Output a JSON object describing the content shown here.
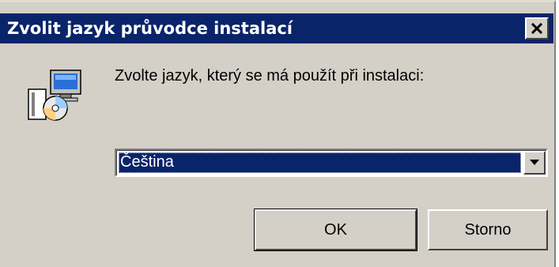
{
  "window": {
    "title": "Zvolit jazyk průvodce instalací",
    "close_icon": "close-icon"
  },
  "dialog": {
    "icon": "setup-installer-icon",
    "prompt": "Zvolte jazyk, který se má použít při instalaci:",
    "language_select": {
      "selected": "Čeština",
      "arrow_icon": "chevron-down-icon"
    },
    "ok_label": "OK",
    "cancel_label": "Storno"
  },
  "colors": {
    "titlebar": "#0a246a",
    "face": "#d4d0c8",
    "selection": "#0a246a",
    "text": "#000000"
  }
}
